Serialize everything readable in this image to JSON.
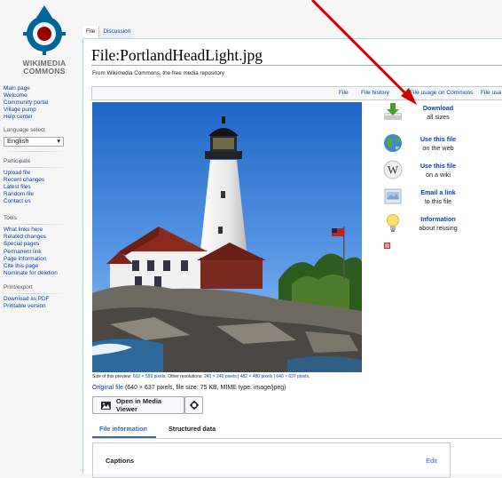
{
  "logo": {
    "line1": "WIKIMEDIA",
    "line2": "COMMONS"
  },
  "sidebar": {
    "nav": [
      "Main page",
      "Welcome",
      "Community portal",
      "Village pump",
      "Help center"
    ],
    "language_heading": "Language select",
    "language_value": "English",
    "participate_heading": "Participate",
    "participate": [
      "Upload file",
      "Recent changes",
      "Latest files",
      "Random file",
      "Contact us"
    ],
    "tools_heading": "Tools",
    "tools": [
      "What links here",
      "Related changes",
      "Special pages",
      "Permanent link",
      "Page information",
      "Cite this page",
      "Nominate for deletion"
    ],
    "print_heading": "Print/export",
    "print": [
      "Download as PDF",
      "Printable version"
    ]
  },
  "tabs": {
    "file": "File",
    "discussion": "Discussion"
  },
  "page": {
    "title": "File:PortlandHeadLight.jpg",
    "subtitle": "From Wikimedia Commons, the free media repository"
  },
  "toc": {
    "file": "File",
    "history": "File history",
    "usage_commons": "File usage on Commons",
    "usage_other": "File usa"
  },
  "actions": [
    {
      "title": "Download",
      "sub": "all sizes",
      "icon": "download-icon"
    },
    {
      "title": "Use this file",
      "sub": "on the web",
      "icon": "globe-icon"
    },
    {
      "title": "Use this file",
      "sub": "on a wiki",
      "icon": "wikipedia-w-icon"
    },
    {
      "title": "Email a link",
      "sub": "to this file",
      "icon": "email-icon"
    },
    {
      "title": "Information",
      "sub": "about reusing",
      "icon": "lightbulb-icon"
    }
  ],
  "preview": {
    "size_label": "Size of this preview:",
    "size_value": "602 × 599 pixels",
    "other_label": ". Other resolutions:",
    "res1": "241 × 240 pixels",
    "res2": "482 × 480 pixels",
    "res3": "640 × 637 pixels",
    "sep": " | ",
    "end": "."
  },
  "original": {
    "link": "Original file",
    "details": " (640 × 637 pixels, file size: 75 KB, MIME type: image/jpeg)"
  },
  "buttons": {
    "media_viewer": "Open in Media Viewer"
  },
  "info_tabs": {
    "file_information": "File information",
    "structured_data": "Structured data"
  },
  "captions": {
    "label": "Captions",
    "edit": "Edit"
  },
  "colors": {
    "link": "#0645ad",
    "accent": "#3366cc",
    "annotation_arrow": "#cc0000"
  }
}
